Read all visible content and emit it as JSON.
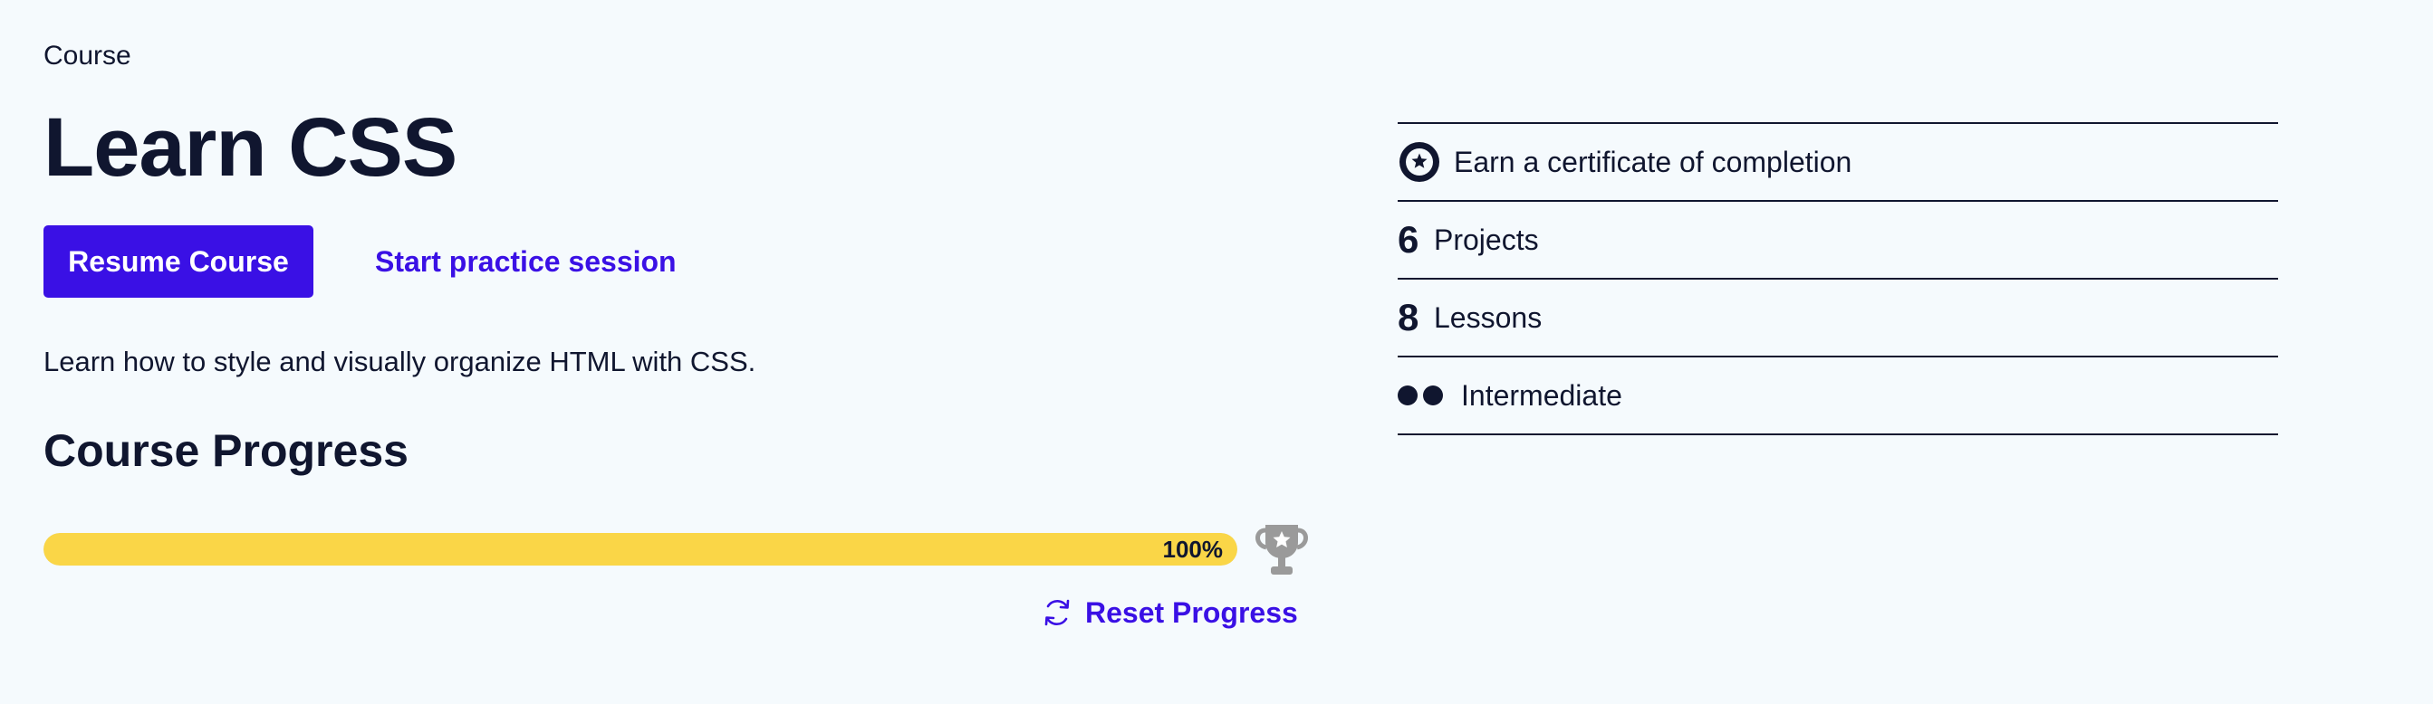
{
  "course": {
    "eyebrow": "Course",
    "title": "Learn CSS",
    "resume_label": "Resume Course",
    "practice_label": "Start practice session",
    "description": "Learn how to style and visually organize HTML with CSS."
  },
  "progress": {
    "heading": "Course Progress",
    "percent": 100,
    "percent_label": "100%",
    "reset_label": "Reset Progress",
    "icons": {
      "trophy": "trophy-icon",
      "reset": "refresh-icon"
    }
  },
  "details": {
    "certificate_label": "Earn a certificate of completion",
    "certificate_icon": "certificate-star-icon",
    "projects_count": "6",
    "projects_label": "Projects",
    "lessons_count": "8",
    "lessons_label": "Lessons",
    "level_label": "Intermediate",
    "level_icon": "difficulty-dots-icon"
  },
  "colors": {
    "background": "#f5fafd",
    "text": "#10162f",
    "accent": "#3a10e5",
    "progress_fill": "#fad647",
    "trophy": "#9a9a9a"
  }
}
